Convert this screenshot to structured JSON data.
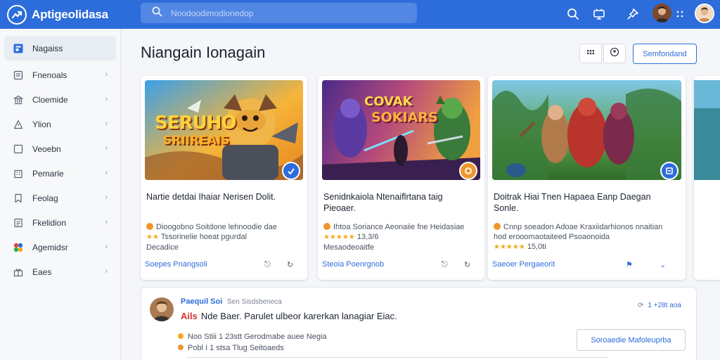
{
  "app": {
    "title": "Aptigeolidasa"
  },
  "search": {
    "placeholder": "Noodoodimodlonedop"
  },
  "sidebar": {
    "items": [
      {
        "label": "Nagaiss",
        "icon": "apps-icon"
      },
      {
        "label": "Fnenoals",
        "icon": "list-icon"
      },
      {
        "label": "Cloemide",
        "icon": "bank-icon"
      },
      {
        "label": "Ylion",
        "icon": "tag-icon"
      },
      {
        "label": "Veoebn",
        "icon": "square-icon"
      },
      {
        "label": "Pemarle",
        "icon": "building-icon"
      },
      {
        "label": "Feolag",
        "icon": "bookmark-icon"
      },
      {
        "label": "Fkelidion",
        "icon": "doc-icon"
      },
      {
        "label": "Agemidsr",
        "icon": "color-wheel-icon"
      },
      {
        "label": "Eaes",
        "icon": "gift-icon"
      }
    ]
  },
  "main": {
    "title": "Niangain Ionagain",
    "primary_button": "Semfondand"
  },
  "cards": [
    {
      "art_title_1": "SERUHO",
      "art_title_2": "SRIIREAIS",
      "title": "Nartie detdai Ihaiar Nerisen Dolit.",
      "desc_1": "Dioogobno Soitdone lehnoodie dae",
      "desc_2": "Tssorinelie hoeat pgurdal",
      "desc_3": "Decadice",
      "link": "Soepes Pnangsoli",
      "colors": {
        "accent": "#2d6ddb"
      }
    },
    {
      "art_title_1": "COVAK",
      "art_title_2": "SOKIARS",
      "title": "Senidnkaiola Ntenaiflrtana taig Pieoaer.",
      "desc_1": "Ihtoa Soriance Aeonaiie fne Heidasiae",
      "rating": "13,3/6",
      "desc_2": "Mesaodeoaitfe",
      "link": "Steoia Poenrgnob",
      "colors": {
        "accent": "#f0962c"
      }
    },
    {
      "title": "Doitrak Hiai Tnen Hapaea Eanp Daegan Sonle.",
      "desc_1": "Cnnp soeadon Adoae Kraxiidarhionos nnaitian",
      "desc_2": "hod erooomaotaiteed Psoaonoida",
      "rating": "15,0ti",
      "link": "Saeoer Pergaeorit",
      "colors": {
        "accent": "#2d6ddb"
      }
    }
  ],
  "post": {
    "author": "Paequil Soi",
    "meta": "Sen Sisdsbeneca",
    "tag": "Ails",
    "headline": "Nde Baer. Parulet ulbeor karerkan lanagiar Eiac.",
    "line1": "Noo Stiii 1 23stt Gerodmabe auee Negia",
    "line2": "Pobl I 1 stsa Tlug Seitoaeds",
    "right_count": "1",
    "right_label": "+28t aoa",
    "button": "Soroaedie Mafoleuprba"
  }
}
